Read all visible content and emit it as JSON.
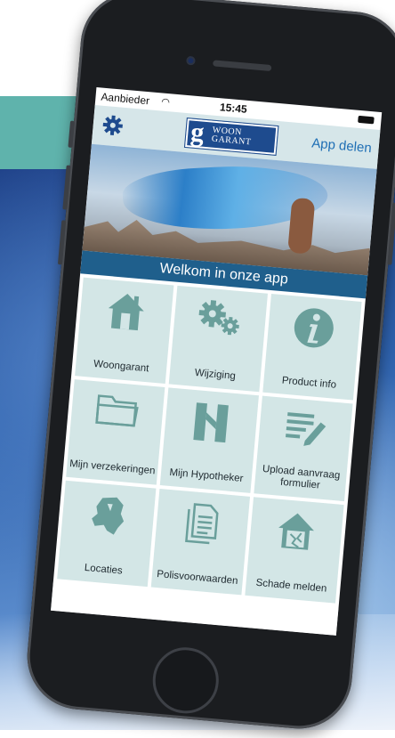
{
  "status_bar": {
    "carrier": "Aanbieder",
    "time": "15:45"
  },
  "nav": {
    "logo_letter": "g",
    "logo_line1": "WOON",
    "logo_line2": "GARANT",
    "share_label": "App delen"
  },
  "banner": {
    "welcome": "Welkom in onze app"
  },
  "tiles": [
    {
      "label": "Woongarant",
      "icon": "house-icon"
    },
    {
      "label": "Wijziging",
      "icon": "gears-icon"
    },
    {
      "label": "Product info",
      "icon": "info-icon"
    },
    {
      "label": "Mijn verzekeringen",
      "icon": "folder-icon"
    },
    {
      "label": "Mijn Hypotheker",
      "icon": "hypotheker-logo-icon"
    },
    {
      "label": "Upload aanvraag formulier",
      "icon": "document-pen-icon"
    },
    {
      "label": "Locaties",
      "icon": "netherlands-map-icon"
    },
    {
      "label": "Polisvoorwaarden",
      "icon": "documents-icon"
    },
    {
      "label": "Schade melden",
      "icon": "damaged-house-icon"
    }
  ],
  "colors": {
    "tile_bg": "#d3e6e6",
    "icon": "#6a9f9b",
    "welcome_bar": "#1f5f8c",
    "nav_bg": "#d6e6e9",
    "link": "#1f6fb5",
    "background_band": "#5fb3ac"
  }
}
